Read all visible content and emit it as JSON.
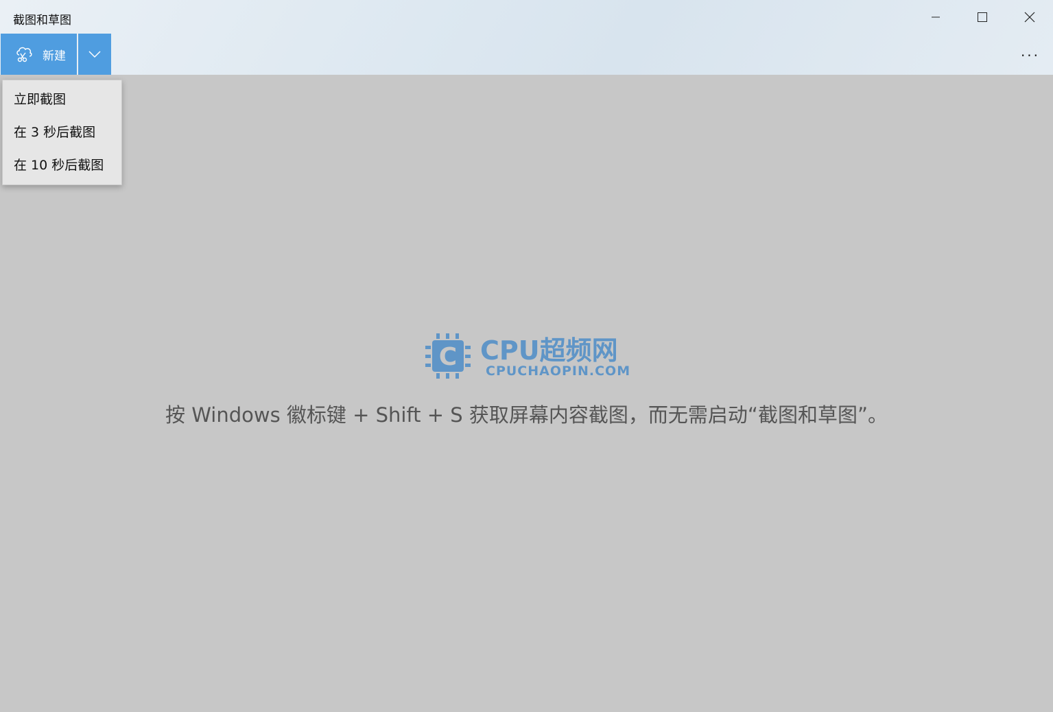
{
  "window": {
    "title": "截图和草图"
  },
  "toolbar": {
    "new_label": "新建",
    "new_icon": "scissors-cloud-icon",
    "dropdown_icon": "chevron-down-icon",
    "more_icon": "more-ellipsis-icon"
  },
  "menu": {
    "items": [
      {
        "label": "立即截图"
      },
      {
        "label": "在 3 秒后截图"
      },
      {
        "label": "在 10 秒后截图"
      }
    ]
  },
  "watermark": {
    "name": "CPU超频网",
    "domain": "CPUCHAOPIN.COM",
    "logo_letter": "C",
    "color": "#4d8dc8"
  },
  "main": {
    "hint": "按 Windows 徽标键 + Shift + S 获取屏幕内容截图，而无需启动“截图和草图”。"
  },
  "colors": {
    "accent": "#4f9de0",
    "canvas": "#c7c7c7"
  }
}
